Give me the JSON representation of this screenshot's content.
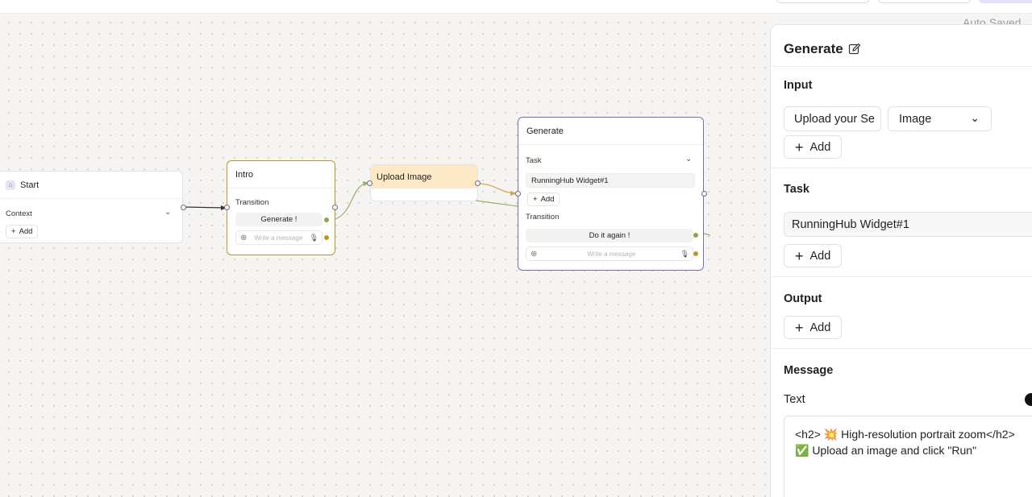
{
  "header": {
    "autosave_text": "Auto Saved"
  },
  "canvas": {
    "nodes": {
      "start": {
        "title": "Start",
        "context_label": "Context",
        "add_label": "Add"
      },
      "intro": {
        "title": "Intro",
        "transition_label": "Transition",
        "transition_button": "Generate !",
        "message_placeholder": "Write a message"
      },
      "upload": {
        "title": "Upload Image"
      },
      "generate": {
        "title": "Generate",
        "task_label": "Task",
        "task_item": "RunningHub Widget#1",
        "add_label": "Add",
        "transition_label": "Transition",
        "transition_button": "Do it again !",
        "message_placeholder": "Write a message"
      }
    }
  },
  "panel": {
    "title": "Generate",
    "input": {
      "label": "Input",
      "field_value": "Upload your Se",
      "type_value": "Image",
      "add_label": "Add"
    },
    "task": {
      "label": "Task",
      "value": "RunningHub Widget#1",
      "add_label": "Add"
    },
    "output": {
      "label": "Output",
      "add_label": "Add"
    },
    "message": {
      "label": "Message",
      "text_label": "Text",
      "line1": "<h2> 💥 High-resolution portrait zoom</h2>",
      "line2": "✅ Upload an image and click \"Run\""
    }
  },
  "colors": {
    "accent_purple": "#7c6fa6",
    "accent_gold": "#b59a2a",
    "upload_header": "#fde8c6",
    "green_port": "#8aa84a"
  }
}
